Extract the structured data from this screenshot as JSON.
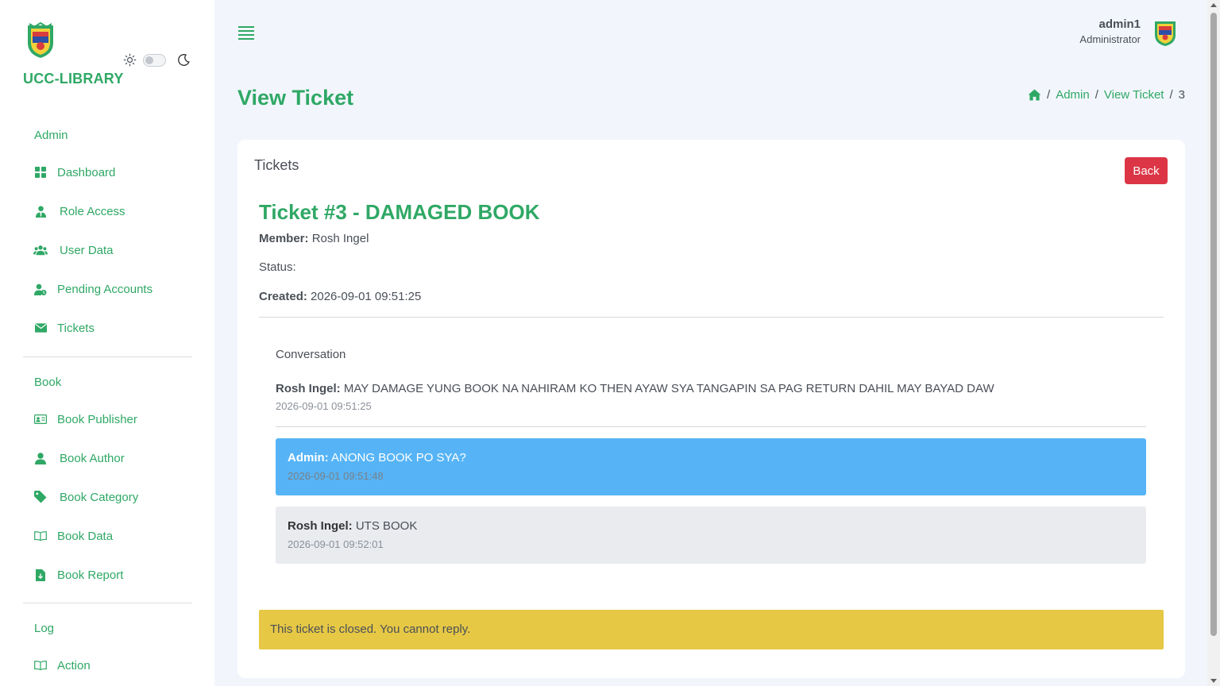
{
  "sidebar": {
    "brand": "UCC-LIBRARY",
    "sections": {
      "admin": "Admin",
      "book": "Book",
      "log": "Log"
    },
    "items": [
      {
        "label": "Dashboard",
        "icon": "dashboard-icon"
      },
      {
        "label": "Role Access",
        "icon": "user-tie-icon"
      },
      {
        "label": "User Data",
        "icon": "users-icon"
      },
      {
        "label": "Pending Accounts",
        "icon": "user-clock-icon"
      },
      {
        "label": "Tickets",
        "icon": "envelope-icon"
      },
      {
        "label": "Book Publisher",
        "icon": "id-card-icon"
      },
      {
        "label": "Book Author",
        "icon": "user-icon"
      },
      {
        "label": "Book Category",
        "icon": "tag-icon"
      },
      {
        "label": "Book Data",
        "icon": "book-open-icon"
      },
      {
        "label": "Book Report",
        "icon": "file-download-icon"
      },
      {
        "label": "Action",
        "icon": "book-open-icon"
      }
    ]
  },
  "header": {
    "user_name": "admin1",
    "user_role": "Administrator"
  },
  "page": {
    "title": "View Ticket",
    "breadcrumb": [
      "Admin",
      "View Ticket",
      "3"
    ]
  },
  "card": {
    "title": "Tickets",
    "back_label": "Back",
    "ticket_heading": "Ticket #3 - DAMAGED BOOK",
    "member_label": "Member:",
    "member_value": "Rosh Ingel",
    "status_label": "Status:",
    "created_label": "Created:",
    "created_value": "2026-09-01 09:51:25",
    "conversation_label": "Conversation",
    "messages": [
      {
        "sender": "Rosh Ingel:",
        "text": "MAY DAMAGE YUNG BOOK NA NAHIRAM KO THEN AYAW SYA TANGAPIN SA PAG RETURN DAHIL MAY BAYAD DAW",
        "time": "2026-09-01 09:51:25"
      },
      {
        "sender": "Admin:",
        "text": "ANONG BOOK PO SYA?",
        "time": "2026-09-01 09:51:48"
      },
      {
        "sender": "Rosh Ingel:",
        "text": "UTS BOOK",
        "time": "2026-09-01 09:52:01"
      }
    ],
    "closed_notice": "This ticket is closed. You cannot reply."
  },
  "colors": {
    "accent": "#2fa865",
    "back_button": "#dc3545",
    "admin_bubble": "#56b4f6",
    "member_bubble": "#e9ebef",
    "alert": "#e6c845"
  }
}
